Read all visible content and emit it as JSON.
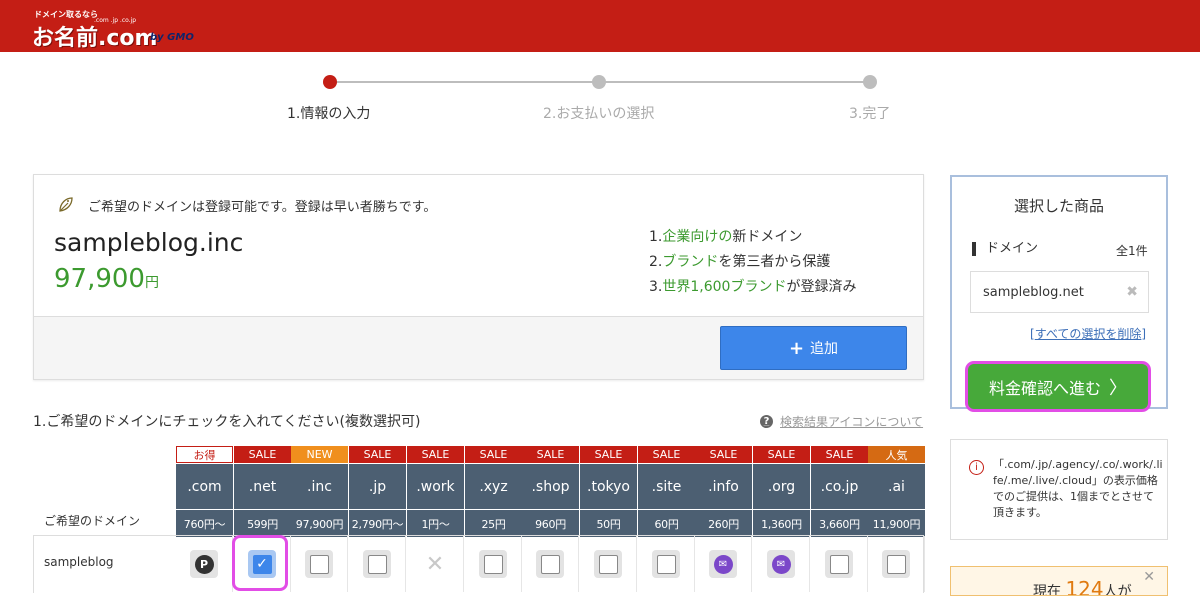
{
  "header": {
    "tagline": "ドメイン取るなら",
    "brand": "お名前.com",
    "tld_hint": ".com .jp .co.jp",
    "by": "by GMO",
    "bg_color": "#c41e15"
  },
  "steps": [
    {
      "label": "1.情報の入力",
      "active": true
    },
    {
      "label": "2.お支払いの選択",
      "active": false
    },
    {
      "label": "3.完了",
      "active": false
    }
  ],
  "result_card": {
    "availability": "ご希望のドメインは登録可能です。登録は早い者勝ちです。",
    "domain": "sampleblog.inc",
    "price": "97,900",
    "price_unit": "円",
    "features": [
      {
        "num": "1.",
        "highlight": "企業向けの",
        "rest": "新ドメイン"
      },
      {
        "num": "2.",
        "highlight": "ブランド",
        "rest": "を第三者から保護"
      },
      {
        "num": "3.",
        "highlight": "世界1,600ブランド",
        "rest": "が登録済み"
      }
    ],
    "add_button": "追加"
  },
  "section": {
    "title": "1.ご希望のドメインにチェックを入れてください(複数選択可)",
    "help_link": "検索結果アイコンについて",
    "row_header": "ご希望のドメイン",
    "row_name": "sampleblog"
  },
  "tlds": [
    {
      "badge": "お得",
      "badge_type": "deal",
      "name": ".com",
      "price": "760円〜",
      "state": "premium"
    },
    {
      "badge": "SALE",
      "badge_type": "sale",
      "name": ".net",
      "price": "599円",
      "state": "checked"
    },
    {
      "badge": "NEW",
      "badge_type": "new",
      "name": ".inc",
      "price": "97,900円",
      "state": "unchecked"
    },
    {
      "badge": "SALE",
      "badge_type": "sale",
      "name": ".jp",
      "price": "2,790円〜",
      "state": "unchecked"
    },
    {
      "badge": "SALE",
      "badge_type": "sale",
      "name": ".work",
      "price": "1円〜",
      "state": "unavailable"
    },
    {
      "badge": "SALE",
      "badge_type": "sale",
      "name": ".xyz",
      "price": "25円",
      "state": "unchecked"
    },
    {
      "badge": "SALE",
      "badge_type": "sale",
      "name": ".shop",
      "price": "960円",
      "state": "unchecked"
    },
    {
      "badge": "SALE",
      "badge_type": "sale",
      "name": ".tokyo",
      "price": "50円",
      "state": "unchecked"
    },
    {
      "badge": "SALE",
      "badge_type": "sale",
      "name": ".site",
      "price": "60円",
      "state": "unchecked"
    },
    {
      "badge": "SALE",
      "badge_type": "sale",
      "name": ".info",
      "price": "260円",
      "state": "mail"
    },
    {
      "badge": "SALE",
      "badge_type": "sale",
      "name": ".org",
      "price": "1,360円",
      "state": "mail"
    },
    {
      "badge": "SALE",
      "badge_type": "sale",
      "name": ".co.jp",
      "price": "3,660円",
      "state": "unchecked"
    },
    {
      "badge": "人気",
      "badge_type": "pop",
      "name": ".ai",
      "price": "11,900円",
      "state": "unchecked"
    }
  ],
  "sidebar": {
    "title": "選択した商品",
    "domain_label": "ドメイン",
    "count": "全1件",
    "selected_item": "sampleblog.net",
    "clear_all": "すべての選択を削除",
    "confirm_button": "料金確認へ進む"
  },
  "notice": {
    "text": "「.com/.jp/.agency/.co/.work/.life/.me/.live/.cloud」の表示価格でのご提供は、1個までとさせて頂きます。"
  },
  "live": {
    "prefix": "現在",
    "count": "124",
    "suffix": "人が"
  }
}
